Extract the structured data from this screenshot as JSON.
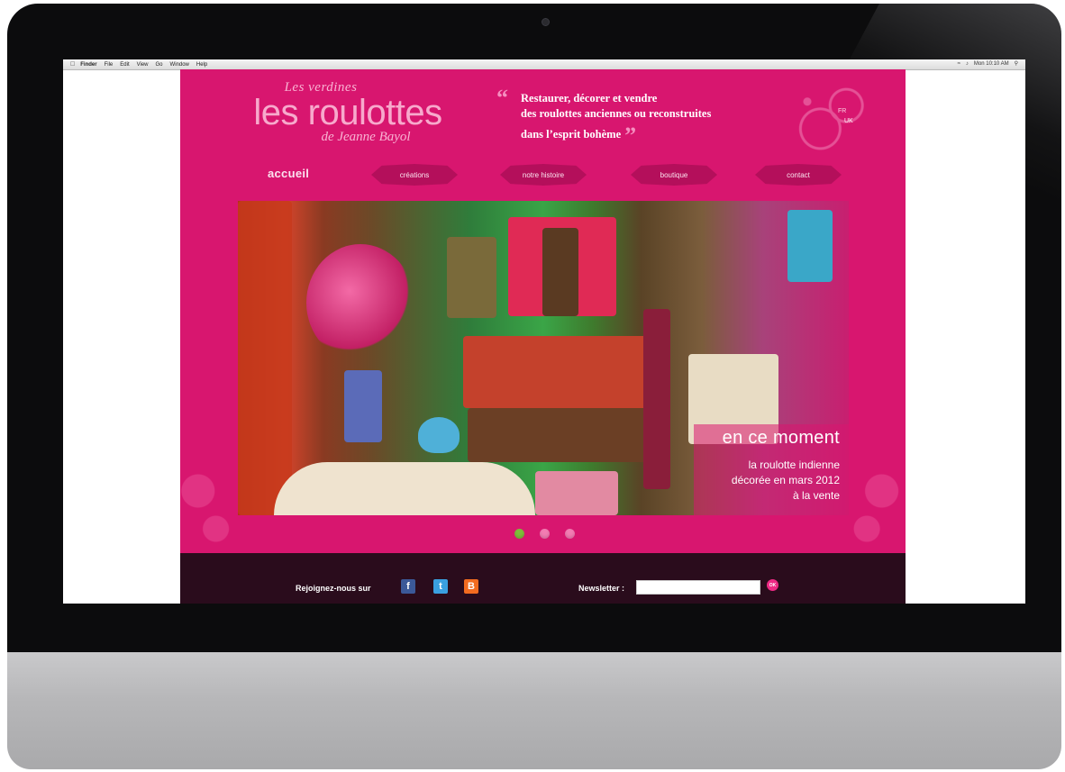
{
  "menubar": {
    "apple": "",
    "items": [
      "Finder",
      "File",
      "Edit",
      "View",
      "Go",
      "Window",
      "Help"
    ],
    "clock": "Mon 10:10 AM"
  },
  "site": {
    "logo": {
      "line1": "Les verdines",
      "line2": "les roulottes",
      "line3": "de Jeanne Bayol"
    },
    "quote": {
      "open": "“",
      "lines": [
        "Restaurer, décorer et vendre",
        "des roulottes anciennes ou reconstruites",
        "dans l’esprit bohème"
      ],
      "close": "”"
    },
    "lang": {
      "fr": "FR",
      "uk": "UK"
    },
    "nav": {
      "home": "accueil",
      "items": [
        "créations",
        "notre histoire",
        "boutique",
        "contact"
      ]
    },
    "hero": {
      "caption_title": "en ce moment",
      "caption_lines": [
        "la roulotte indienne",
        "décorée en mars 2012",
        "à la vente"
      ]
    },
    "slider": {
      "count": 3,
      "active": 0
    },
    "footer": {
      "join_label": "Rejoignez-nous sur",
      "social": [
        "f",
        "t",
        "B"
      ],
      "newsletter_label": "Newsletter :",
      "newsletter_value": "",
      "ok_label": "OK"
    }
  },
  "colors": {
    "brand": "#d8166f",
    "footer": "#2a0c1c",
    "active_dot": "#7fbd3a"
  },
  "icons": [
    "apple-icon",
    "facebook-icon",
    "twitter-icon",
    "blogger-icon",
    "wifi-icon",
    "volume-icon",
    "spotlight-icon"
  ]
}
